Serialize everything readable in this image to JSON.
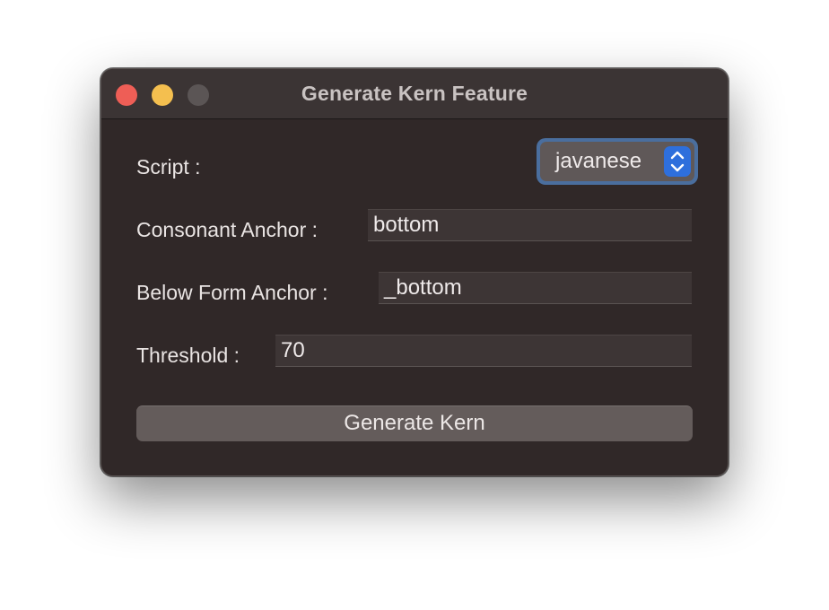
{
  "window": {
    "title": "Generate Kern Feature",
    "controls": [
      "close",
      "minimize",
      "zoom"
    ]
  },
  "form": {
    "script_label": "Script :",
    "script_value": "javanese",
    "consonant_anchor_label": "Consonant Anchor :",
    "consonant_anchor_value": "bottom",
    "below_form_anchor_label": "Below Form Anchor :",
    "below_form_anchor_value": "_bottom",
    "threshold_label": "Threshold :",
    "threshold_value": "70",
    "generate_button_label": "Generate Kern"
  },
  "colors": {
    "close": "#ee5e56",
    "minimize": "#f4bf4f",
    "zoom_inactive": "#5b5555",
    "focus_ring": "#4a6e9e",
    "popup_arrow_accent": "#2e6fdc",
    "window_background": "#302828"
  },
  "icons": {
    "popup_arrows": "chevron-up-down-icon"
  }
}
